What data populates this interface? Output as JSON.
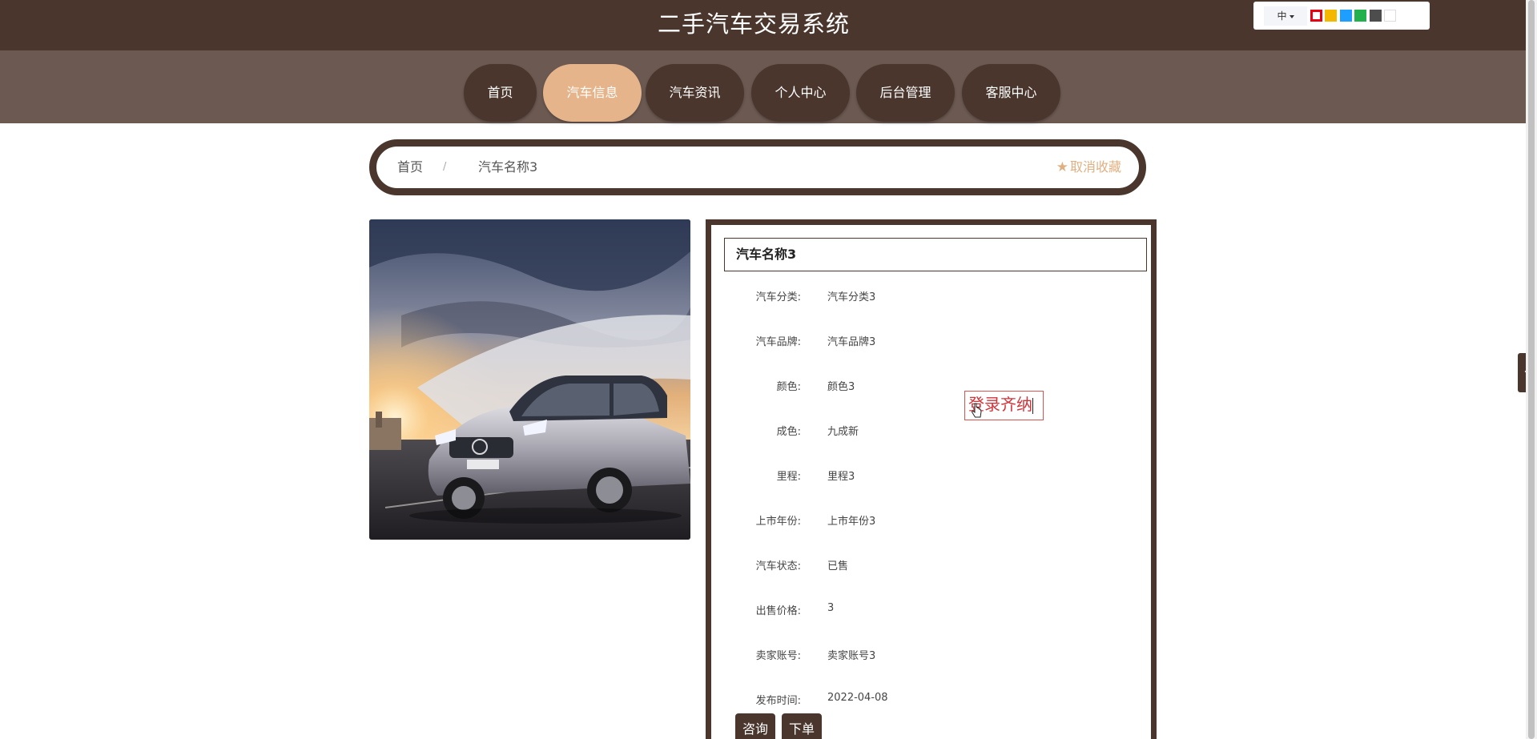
{
  "site": {
    "title": "二手汽车交易系统"
  },
  "theme_switcher": {
    "language": "中",
    "swatches": [
      {
        "name": "theme-swatch-red",
        "color": "#e60012"
      },
      {
        "name": "theme-swatch-yellow",
        "color": "#f5b800"
      },
      {
        "name": "theme-swatch-blue",
        "color": "#1e9fff"
      },
      {
        "name": "theme-swatch-green",
        "color": "#22b14c"
      },
      {
        "name": "theme-swatch-gray",
        "color": "#4d4d4d"
      },
      {
        "name": "theme-swatch-white",
        "color": "#ffffff"
      }
    ]
  },
  "nav": {
    "items": [
      {
        "label": "首页",
        "active": false
      },
      {
        "label": "汽车信息",
        "active": true
      },
      {
        "label": "汽车资讯",
        "active": false
      },
      {
        "label": "个人中心",
        "active": false
      },
      {
        "label": "后台管理",
        "active": false
      },
      {
        "label": "客服中心",
        "active": false
      }
    ]
  },
  "breadcrumb": {
    "home": "首页",
    "separator": "/",
    "current": "汽车名称3",
    "favorite": "取消收藏",
    "favorite_icon": "star-icon"
  },
  "detail": {
    "title": "汽车名称3",
    "fields": [
      {
        "label": "汽车分类:",
        "value": "汽车分类3"
      },
      {
        "label": "汽车品牌:",
        "value": "汽车品牌3"
      },
      {
        "label": "颜色:",
        "value": "颜色3"
      },
      {
        "label": "成色:",
        "value": "九成新"
      },
      {
        "label": "里程:",
        "value": "里程3"
      },
      {
        "label": "上市年份:",
        "value": "上市年份3"
      },
      {
        "label": "汽车状态:",
        "value": "已售"
      },
      {
        "label": "出售价格:",
        "value": "3"
      },
      {
        "label": "卖家账号:",
        "value": "卖家账号3"
      },
      {
        "label": "发布时间:",
        "value": "2022-04-08"
      }
    ],
    "buttons": {
      "consult": "咨询",
      "order": "下单"
    }
  },
  "overlay": {
    "text": "登录齐纳"
  },
  "colors": {
    "brand_dark": "#4a362d",
    "nav_band": "#6c5a52",
    "accent": "#e6b48b",
    "favorite": "#e0b083"
  }
}
